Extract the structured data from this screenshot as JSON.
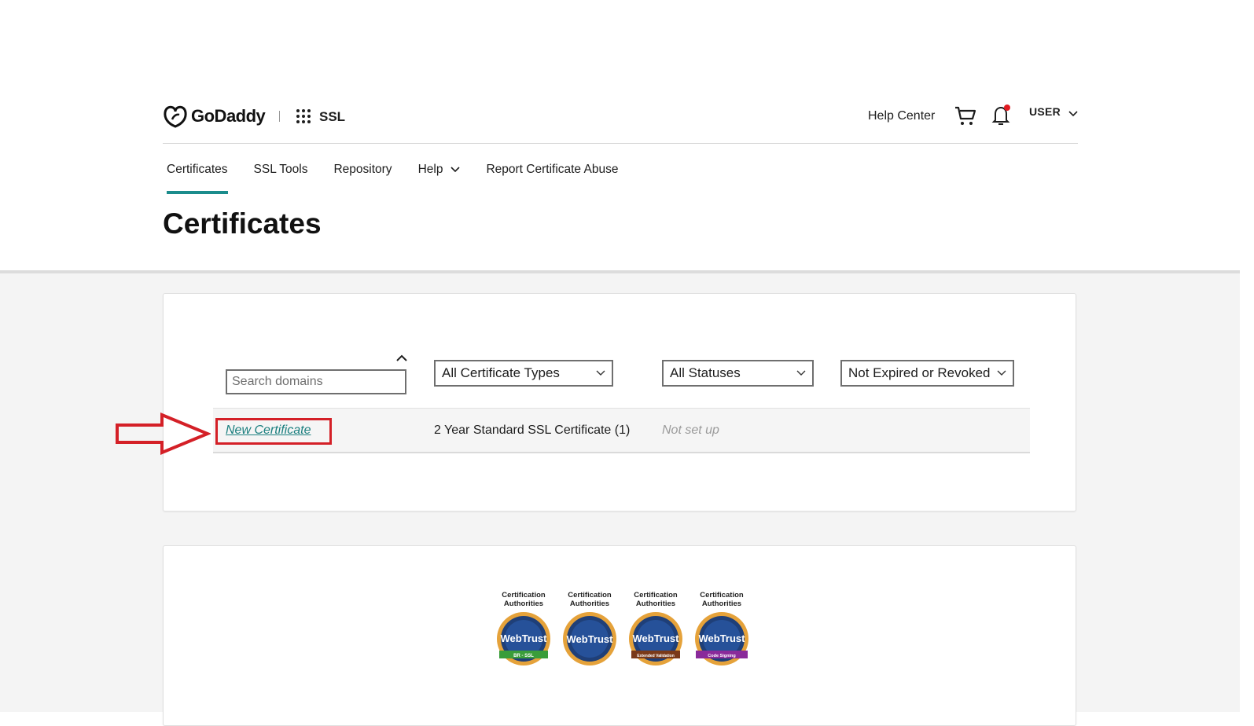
{
  "header": {
    "brand": "GoDaddy",
    "product": "SSL",
    "help_center": "Help Center",
    "user_label": "USER"
  },
  "nav": {
    "items": [
      {
        "label": "Certificates",
        "active": true
      },
      {
        "label": "SSL Tools"
      },
      {
        "label": "Repository"
      },
      {
        "label": "Help",
        "has_dropdown": true
      },
      {
        "label": "Report Certificate Abuse"
      }
    ]
  },
  "page": {
    "title": "Certificates"
  },
  "filters": {
    "search_placeholder": "Search domains",
    "certificate_type": "All Certificate Types",
    "status": "All Statuses",
    "expiry": "Not Expired or Revoked"
  },
  "certificates": [
    {
      "name": "New Certificate",
      "type": "2 Year Standard SSL Certificate (1)",
      "status": "Not set up"
    }
  ],
  "badges": [
    {
      "caption_line1": "Certification",
      "caption_line2": "Authorities",
      "seal": "WebTrust",
      "ribbon": "BR - SSL",
      "ribbon_color": "#3a9d3a"
    },
    {
      "caption_line1": "Certification",
      "caption_line2": "Authorities",
      "seal": "WebTrust",
      "ribbon": "",
      "ribbon_color": ""
    },
    {
      "caption_line1": "Certification",
      "caption_line2": "Authorities",
      "seal": "WebTrust",
      "ribbon": "Extended Validation",
      "ribbon_color": "#7a3a1a"
    },
    {
      "caption_line1": "Certification",
      "caption_line2": "Authorities",
      "seal": "WebTrust",
      "ribbon": "Code Signing",
      "ribbon_color": "#8a2a9a"
    }
  ],
  "colors": {
    "accent": "#1b8c8c",
    "link": "#1b7f7f",
    "annotation": "#d42027",
    "page_gray": "#f4f4f4"
  },
  "icons": [
    "godaddy-logo-icon",
    "apps-grid-icon",
    "cart-icon",
    "bell-icon",
    "chevron-down-icon",
    "chevron-up-icon",
    "annotation-arrow-icon",
    "webtrust-seal-icon"
  ]
}
